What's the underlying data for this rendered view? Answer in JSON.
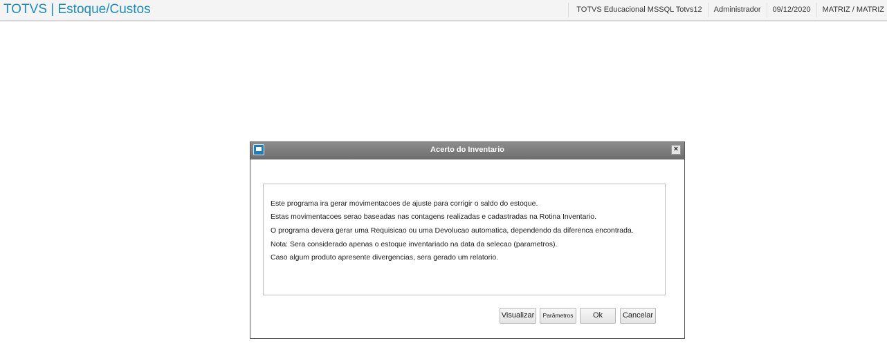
{
  "header": {
    "app_title": "TOTVS | Estoque/Custos",
    "environment": "TOTVS Educacional MSSQL Totvs12",
    "user": "Administrador",
    "date": "09/12/2020",
    "branch": "MATRIZ / MATRIZ"
  },
  "dialog": {
    "title": "Acerto do Inventario",
    "icon": "app-window-icon",
    "close_glyph": "×",
    "lines": [
      "Este programa ira gerar movimentacoes de ajuste para corrigir o saldo do estoque.",
      "Estas movimentacoes serao baseadas nas contagens realizadas e cadastradas na Rotina Inventario.",
      "O programa devera gerar uma Requisicao ou uma Devolucao automatica, dependendo da diferenca encontrada.",
      "Nota: Sera considerado apenas o estoque inventariado na data da selecao (parametros).",
      "Caso algum produto apresente divergencias, sera gerado um relatorio."
    ],
    "buttons": {
      "visualizar": "Visualizar",
      "parametros": "Parâmetros",
      "ok": "Ok",
      "cancelar": "Cancelar"
    }
  },
  "colors": {
    "title_accent": "#1a8dc0",
    "dialog_titlebar": "#7c7c7c"
  }
}
